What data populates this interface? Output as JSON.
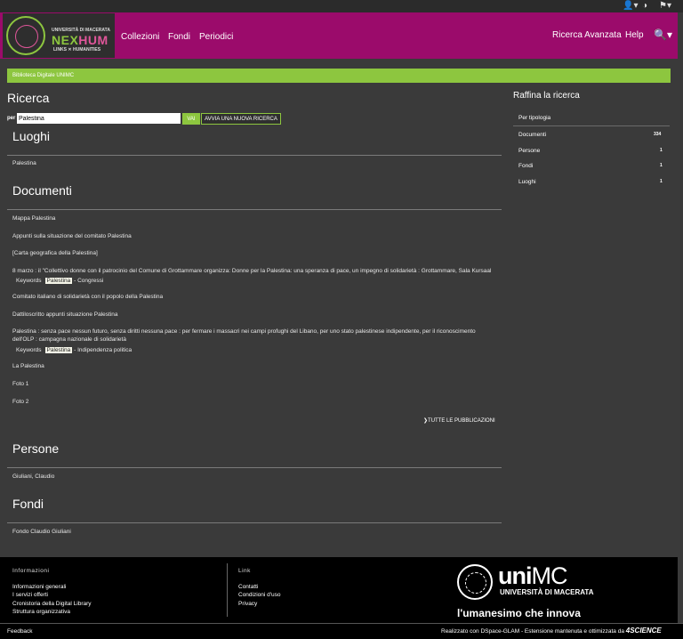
{
  "topbar": {
    "user_icon": "👤▾",
    "contrast_icon": "◑",
    "flag_icon": "⚑▾"
  },
  "logo": {
    "university": "UNIVERSITÀ DI MACERATA",
    "nex": "NEX",
    "hum": "HUM",
    "links_humanities": "LINKS  ✕  HUMANITIES"
  },
  "nav": {
    "items": [
      "Collezioni",
      "Fondi",
      "Periodici"
    ],
    "advanced": "Ricerca Avanzata",
    "help": "Help",
    "search_icon": "🔍▾"
  },
  "breadcrumb": "Biblioteca Digitale UNIMC",
  "search": {
    "heading": "Ricerca",
    "per_label": "per",
    "query": "Palestina",
    "go_label": "VAI",
    "new_search_label": "AVVIA UNA NUOVA RICERCA"
  },
  "sections": {
    "luoghi": {
      "title": "Luoghi",
      "items": [
        "Palestina"
      ]
    },
    "documenti": {
      "title": "Documenti",
      "items": [
        "Mappa Palestina",
        "Appunti sulla situazione del comitato Palestina",
        "[Carta geografica della Palestina]",
        "8 marzo : il \"Collettivo donne con il patrocinio del Comune di Grottammare organizza: Donne per la Palestina: una speranza di pace, un impegno di solidarietà : Grottammare, Sala Kursaal",
        "Comitato italiano di solidarietà con il popolo della Palestina",
        "Dattiloscritto appunti situazione Palestina",
        "Palestina : senza pace nessun futuro, senza diritti nessuna pace : per fermare i massacri nei campi profughi del Libano, per uno stato palestinese indipendente, per il riconoscimento dell'OLP : campagna nazionale di solidarietà",
        "La Palestina",
        "Foto 1",
        "Foto 2"
      ],
      "keywords": [
        {
          "label": "Keywords",
          "tag": "Palestina",
          "rest": "- Congressi"
        },
        {
          "label": "Keywords",
          "tag": "Palestina",
          "rest": "- Indipendenza politica"
        }
      ],
      "all_label": "TUTTE LE PUBBLICAZIONI"
    },
    "persone": {
      "title": "Persone",
      "items": [
        "Giuliani, Claudio"
      ]
    },
    "fondi": {
      "title": "Fondi",
      "items": [
        "Fondo Claudio Giuliani"
      ]
    }
  },
  "sidebar": {
    "title": "Raffina la ricerca",
    "subtitle": "Per tipologia",
    "facets": [
      {
        "label": "Documenti",
        "count": "334"
      },
      {
        "label": "Persone",
        "count": "1"
      },
      {
        "label": "Fondi",
        "count": "1"
      },
      {
        "label": "Luoghi",
        "count": "1"
      }
    ]
  },
  "footer": {
    "info_title": "Informazioni",
    "info_links": [
      "Informazioni generali",
      "I servizi offerti",
      "Cronistoria della Digital Library",
      "Struttura organizzativa"
    ],
    "link_title": "Link",
    "link_links": [
      "Contatti",
      "Condizioni d'uso",
      "Privacy"
    ],
    "unimc_uni": "uni",
    "unimc_mc": "MC",
    "unimc_sub": "UNIVERSITÀ DI MACERATA",
    "slogan": "l'umanesimo che innova",
    "feedback": "Feedback",
    "powered": "Realizzato con DSpace-GLAM - Estensione mantenuta e ottimizzata da",
    "brand": "4SCIENCE"
  },
  "colors": {
    "header": "#9b0b6b",
    "accent": "#8dc63f",
    "background": "#3a3a3a"
  }
}
